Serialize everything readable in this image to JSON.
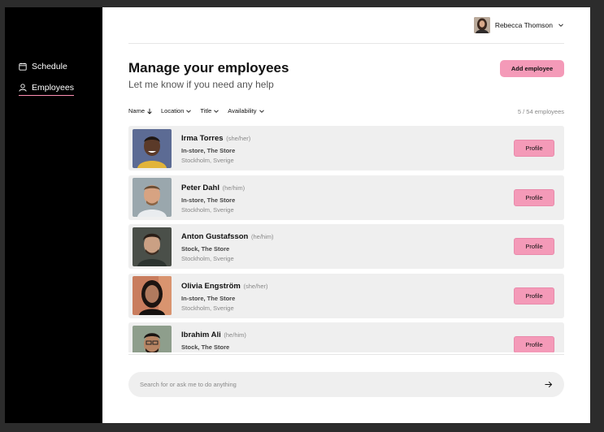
{
  "sidebar": {
    "items": [
      {
        "label": "Schedule",
        "icon": "calendar-icon"
      },
      {
        "label": "Employees",
        "icon": "person-icon",
        "active": true
      }
    ]
  },
  "header": {
    "user_name": "Rebecca Thomson"
  },
  "page": {
    "title": "Manage your employees",
    "subtitle": "Let me know if you need any help",
    "add_button": "Add employee"
  },
  "filters": [
    {
      "label": "Name",
      "icon": "arrow-down-icon"
    },
    {
      "label": "Location",
      "icon": "chevron-down-icon"
    },
    {
      "label": "Title",
      "icon": "chevron-down-icon"
    },
    {
      "label": "Availability",
      "icon": "chevron-down-icon"
    }
  ],
  "count": "5 / 54 employees",
  "employees": [
    {
      "name": "Irma Torres",
      "pronouns": "(she/her)",
      "role": "In-store, The Store",
      "location": "Stockholm, Sverige",
      "button": "Profile"
    },
    {
      "name": "Peter Dahl",
      "pronouns": "(he/him)",
      "role": "In-store, The Store",
      "location": "Stockholm, Sverige",
      "button": "Profile"
    },
    {
      "name": "Anton Gustafsson",
      "pronouns": "(he/him)",
      "role": "Stock, The Store",
      "location": "Stockholm, Sverige",
      "button": "Profile"
    },
    {
      "name": "Olivia Engström",
      "pronouns": "(she/her)",
      "role": "In-store, The Store",
      "location": "Stockholm, Sverige",
      "button": "Profile"
    },
    {
      "name": "Ibrahim Ali",
      "pronouns": "(he/him)",
      "role": "Stock, The Store",
      "location": "",
      "button": "Profile"
    }
  ],
  "chat": {
    "placeholder": "Search for or ask me to do anything"
  },
  "colors": {
    "accent": "#f49ab8",
    "sidebar_bg": "#000000",
    "row_bg": "#efefef",
    "active_underline": "#ff8fb3"
  }
}
